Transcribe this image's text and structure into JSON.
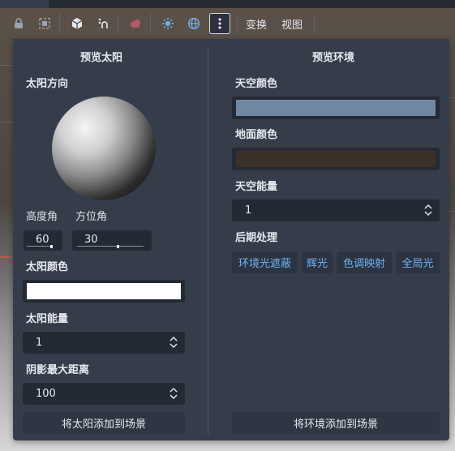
{
  "toolbar": {
    "icons": [
      "lock-icon",
      "group-icon",
      "cube-icon",
      "snap-icon",
      "cloud-icon",
      "sun-icon",
      "globe-icon",
      "more-icon"
    ],
    "transform_menu": "变换",
    "view_menu": "视图"
  },
  "sun_panel": {
    "title": "预览太阳",
    "direction_label": "太阳方向",
    "elevation_label": "高度角",
    "azimuth_label": "方位角",
    "elevation_value": "60",
    "azimuth_value": "30",
    "color_label": "太阳颜色",
    "color": "#ffffff",
    "energy_label": "太阳能量",
    "energy_value": "1",
    "shadow_label": "阴影最大距离",
    "shadow_value": "100",
    "add_button": "将太阳添加到场景"
  },
  "env_panel": {
    "title": "预览环境",
    "sky_color_label": "天空颜色",
    "sky_color": "#6f87a3",
    "ground_color_label": "地面颜色",
    "ground_color": "#3b3128",
    "sky_energy_label": "天空能量",
    "sky_energy_value": "1",
    "post_label": "后期处理",
    "post_buttons": [
      "环境光遮蔽",
      "辉光",
      "色调映射",
      "全局光"
    ],
    "add_button": "将环境添加到场景"
  },
  "colors": {
    "panel_bg": "#363d4a",
    "field_bg": "#242a34",
    "accent": "#6fb3f2"
  }
}
